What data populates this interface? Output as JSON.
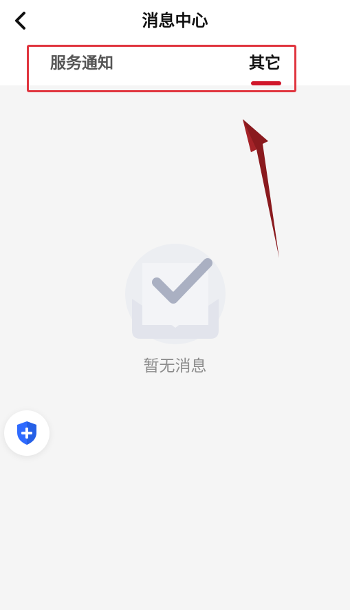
{
  "header": {
    "title": "消息中心",
    "back_icon": "chevron-left-icon"
  },
  "tabs": [
    {
      "label": "服务通知",
      "active": false
    },
    {
      "label": "其它",
      "active": true
    }
  ],
  "empty_state": {
    "icon": "checkmark-envelope-icon",
    "text": "暂无消息"
  },
  "floating_button": {
    "icon": "shield-plus-icon"
  },
  "colors": {
    "active_tab_underline": "#d0162a",
    "highlight_box": "#e0353f",
    "arrow": "#8a1a1e",
    "shield_blue": "#2f6bff"
  }
}
